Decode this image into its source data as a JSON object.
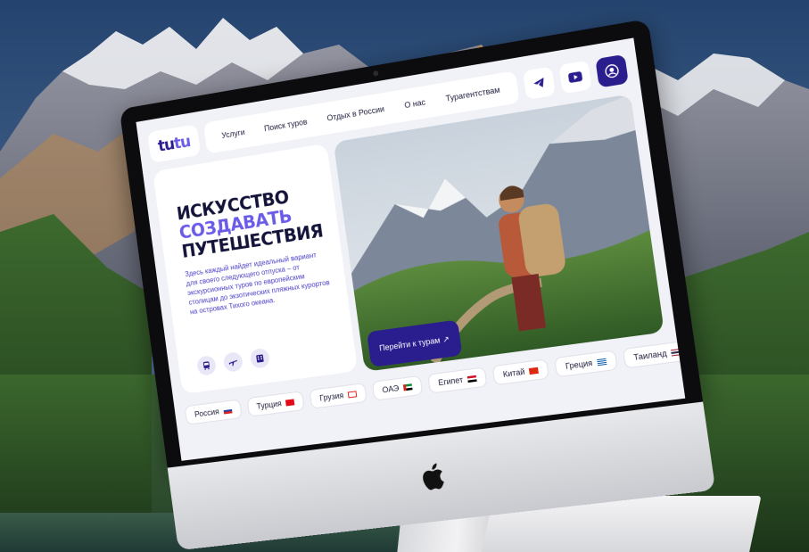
{
  "site": {
    "logo": {
      "part1": "tu",
      "part2": "tu"
    },
    "nav": [
      "Услуги",
      "Поиск туров",
      "Отдых в России",
      "О нас",
      "Турагентствам"
    ],
    "hero": {
      "line1": "ИСКУССТВО",
      "line2": "СОЗДАВАТЬ",
      "line3": "ПУТЕШЕСТВИЯ",
      "lead": "Здесь каждый найдет идеальный вариант для своего следующего отпуска – от экскурсионных туров по европейским столицам до экзотических пляжных курортов на островах Тихого океана.",
      "cta": "Перейти к турам",
      "cta_arrow": "↗"
    },
    "countries": [
      "Россия",
      "Турция",
      "Грузия",
      "ОАЭ",
      "Египет",
      "Китай",
      "Греция",
      "Таиланд"
    ]
  },
  "colors": {
    "brand": "#2a1d8e",
    "accent": "#6b5ce7",
    "sky": "#2c4a6e"
  },
  "icons": [
    "telegram-icon",
    "youtube-icon",
    "user-icon",
    "bus-icon",
    "plane-icon",
    "hotel-icon",
    "apple-icon"
  ]
}
